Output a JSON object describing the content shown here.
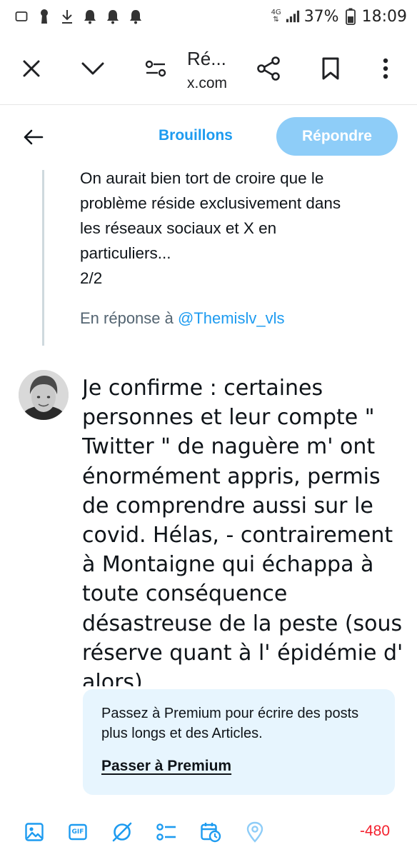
{
  "status_bar": {
    "network": "4G",
    "battery_percent": "37%",
    "time": "18:09"
  },
  "browser_bar": {
    "page_title": "Ré...",
    "domain": "x.com"
  },
  "compose_header": {
    "drafts_label": "Brouillons",
    "reply_label": "Répondre"
  },
  "parent_post": {
    "text": "On aurait bien tort de croire que le\nproblème réside exclusivement dans\nles réseaux sociaux et X en\nparticuliers...\n2/2",
    "reply_prefix": "En réponse à ",
    "reply_handle": "@Themislv_vls"
  },
  "compose": {
    "text": "Je confirme : certaines personnes et leur compte \" Twitter \" de naguère m' ont énormément appris, permis de comprendre aussi sur le covid. Hélas, - contrairement à Montaigne qui échappa à toute conséquence désastreuse de la peste (sous réserve quant à l' épidémie d' alors)"
  },
  "premium_prompt": {
    "text": "Passez à Premium pour écrire des posts plus longs et des Articles.",
    "link": "Passer à Premium"
  },
  "toolbar": {
    "icons": [
      "image-icon",
      "gif-icon",
      "grok-icon",
      "poll-icon",
      "schedule-icon",
      "location-icon"
    ],
    "gif_label": "GIF",
    "char_count": "-480"
  },
  "colors": {
    "accent": "#1d9bf0",
    "accent_disabled": "#8ecdf8",
    "premium_bg": "#e7f5fe",
    "over_limit": "#f4212e"
  }
}
